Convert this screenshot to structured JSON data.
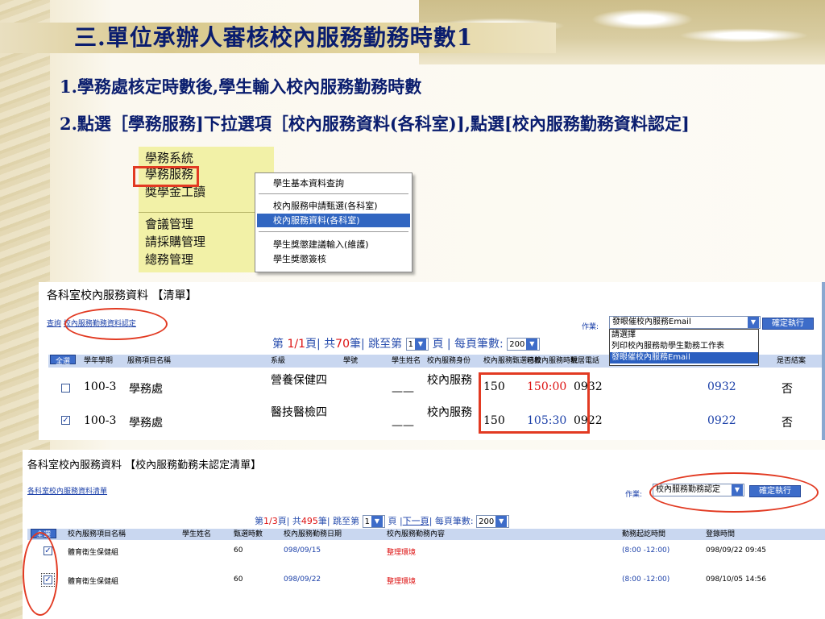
{
  "slide": {
    "title": "三.單位承辦人審核校內服務勤務時數1",
    "bullet1": "1.學務處核定時數後,學生輸入校內服務勤務時數",
    "bullet2": "2.點選［學務服務]下拉選項［校內服務資料(各科室)],點選[校內服務勤務資料認定]"
  },
  "menu": {
    "items": [
      "學務系統",
      "學務服務",
      "獎學金工讀",
      "會議管理",
      "請採購管理",
      "總務管理"
    ],
    "dropdown": [
      "學生基本資料查詢",
      "校內服務申請甄選(各科室)",
      "校內服務資料(各科室)",
      "學生獎懲建議輸入(維護)",
      "學生獎懲簽核"
    ]
  },
  "panel1": {
    "title": "各科室校內服務資料 【清單】",
    "link_query": "查詢",
    "link_confirm": "校內服務勤務資料認定",
    "pager_prefix": "第",
    "pager_page": "1/1",
    "pager_mid": "頁| 共",
    "pager_total": "70",
    "pager_mid2": "筆| 跳至第",
    "pager_page_select": "1",
    "pager_mid3": "頁 | 每頁筆數:",
    "pager_per_page": "200",
    "action_label": "作業:",
    "action_selected": "發眼催校內服務Email",
    "action_options": [
      "請選擇",
      "列印校內服務助學生勤務工作表",
      "發眼催校內服務Email"
    ],
    "exec_button": "確定執行",
    "select_all": "全選",
    "columns": [
      "學年學期",
      "服務項目名稱",
      "系級",
      "學號",
      "學生姓名",
      "校內服務身份",
      "校內服務甄選時數",
      "已校內服務時數",
      "現居電話",
      "是否結案"
    ],
    "rows": [
      {
        "term": "100-3",
        "unit": "學務處",
        "dept": "營養保健四",
        "name": "——",
        "role": "校內服務",
        "hours": "150",
        "served": "150:00",
        "phone": "0932",
        "mobile": "0932",
        "closed": "否",
        "checked": ""
      },
      {
        "term": "100-3",
        "unit": "學務處",
        "dept": "醫技醫檢四",
        "name": "——",
        "role": "校內服務",
        "hours": "150",
        "served": "105:30",
        "phone": "0922",
        "mobile": "0922",
        "closed": "否",
        "checked": "✓"
      }
    ]
  },
  "panel2": {
    "title": "各科室校內服務資料 【校內服務勤務未認定清單】",
    "link_list": "各科室校內服務資料清單",
    "pager_prefix": "第",
    "pager_page": "1/3",
    "pager_mid": "頁| 共",
    "pager_total": "495",
    "pager_mid2": "筆| 跳至第",
    "pager_page_select": "1",
    "pager_mid3": "頁 |",
    "pager_next": "下一頁",
    "pager_mid4": "| 每頁筆數:",
    "pager_per_page": "200",
    "action_label": "作業:",
    "action_selected": "校內服務勤務認定",
    "exec_button": "確定執行",
    "select_all": "全選",
    "columns": [
      "校內服務項目名稱",
      "學生姓名",
      "甄選時數",
      "校內服務勤務日期",
      "校內服務勤務內容",
      "勤務起訖時間",
      "登錄時間"
    ],
    "rows": [
      {
        "item": "體育衛生保健組",
        "hours": "60",
        "date": "098/09/15",
        "content": "整理環境",
        "time": "(8:00 -12:00)",
        "logged": "098/09/22 09:45",
        "checked": "✓"
      },
      {
        "item": "體育衛生保健組",
        "hours": "60",
        "date": "098/09/22",
        "content": "整理環境",
        "time": "(8:00 -12:00)",
        "logged": "098/10/05 14:56",
        "checked": "✓"
      }
    ]
  }
}
